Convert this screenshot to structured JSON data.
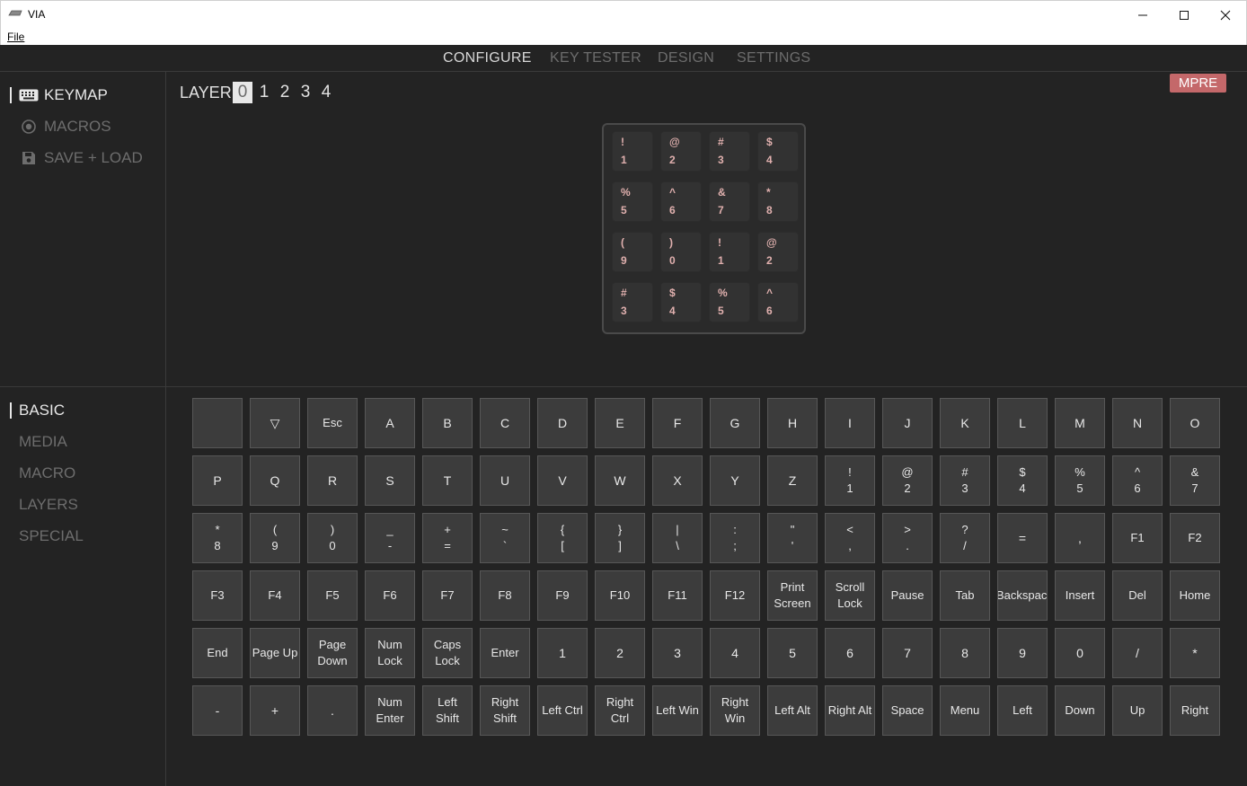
{
  "window": {
    "title": "VIA",
    "minimize": "—",
    "maximize": "☐",
    "close": "✕"
  },
  "menu": {
    "file": "File"
  },
  "nav": {
    "tabs": [
      "CONFIGURE",
      "KEY TESTER",
      "DESIGN",
      "SETTINGS"
    ],
    "active": "CONFIGURE"
  },
  "sidebar_top": {
    "items": [
      {
        "label": "KEYMAP",
        "icon": "keyboard-icon"
      },
      {
        "label": "MACROS",
        "icon": "record-icon"
      },
      {
        "label": "SAVE + LOAD",
        "icon": "floppy-icon"
      }
    ]
  },
  "layers": {
    "label": "LAYER",
    "items": [
      "0",
      "1",
      "2",
      "3",
      "4"
    ],
    "selected": "0"
  },
  "badge": "MPRE",
  "keymap": [
    [
      "!",
      "1"
    ],
    [
      "@",
      "2"
    ],
    [
      "#",
      "3"
    ],
    [
      "$",
      "4"
    ],
    [
      "%",
      "5"
    ],
    [
      "^",
      "6"
    ],
    [
      "&",
      "7"
    ],
    [
      "*",
      "8"
    ],
    [
      "(",
      "9"
    ],
    [
      ")",
      "0"
    ],
    [
      "!",
      "1"
    ],
    [
      "@",
      "2"
    ],
    [
      "#",
      "3"
    ],
    [
      "$",
      "4"
    ],
    [
      "%",
      "5"
    ],
    [
      "^",
      "6"
    ]
  ],
  "sidebar_bottom": {
    "items": [
      "BASIC",
      "MEDIA",
      "MACRO",
      "LAYERS",
      "SPECIAL"
    ]
  },
  "keys": [
    [
      "",
      "▽",
      "Esc",
      "A",
      "B",
      "C",
      "D",
      "E",
      "F",
      "G",
      "H",
      "I",
      "J",
      "K",
      "L",
      "M",
      "N",
      "O"
    ],
    [
      "P",
      "Q",
      "R",
      "S",
      "T",
      "U",
      "V",
      "W",
      "X",
      "Y",
      "Z",
      "!\n1",
      "@\n2",
      "#\n3",
      "$\n4",
      "%\n5",
      "^\n6",
      "&\n7"
    ],
    [
      "*\n8",
      "(\n9",
      ")\n0",
      "_\n-",
      "+\n=",
      "~\n`",
      "{\n[",
      "}\n]",
      "|\n\\",
      ":\n;",
      "\"\n'",
      "<\n,",
      ">\n.",
      "?\n/",
      "=",
      ",",
      "F1",
      "F2"
    ],
    [
      "F3",
      "F4",
      "F5",
      "F6",
      "F7",
      "F8",
      "F9",
      "F10",
      "F11",
      "F12",
      "Print\nScreen",
      "Scroll\nLock",
      "Pause",
      "Tab",
      "Backspace",
      "Insert",
      "Del",
      "Home"
    ],
    [
      "End",
      "Page Up",
      "Page\nDown",
      "Num\nLock",
      "Caps\nLock",
      "Enter",
      "1",
      "2",
      "3",
      "4",
      "5",
      "6",
      "7",
      "8",
      "9",
      "0",
      "/",
      "*"
    ],
    [
      "-",
      "+",
      ".",
      "Num\nEnter",
      "Left\nShift",
      "Right\nShift",
      "Left Ctrl",
      "Right\nCtrl",
      "Left Win",
      "Right\nWin",
      "Left Alt",
      "Right Alt",
      "Space",
      "Menu",
      "Left",
      "Down",
      "Up",
      "Right"
    ]
  ],
  "colors": {
    "background": "#232323",
    "accent": "#c4686a",
    "legend": "#e0b0ae"
  }
}
